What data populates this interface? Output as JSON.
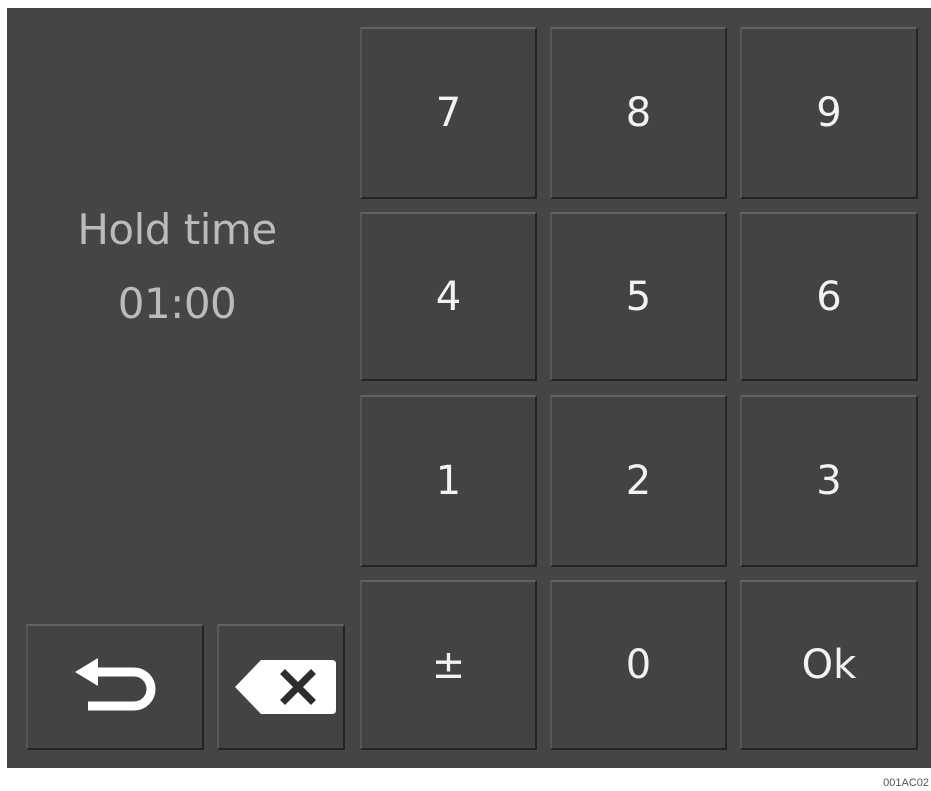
{
  "display": {
    "label": "Hold time",
    "value": "01:00"
  },
  "keypad": {
    "key_7": "7",
    "key_8": "8",
    "key_9": "9",
    "key_4": "4",
    "key_5": "5",
    "key_6": "6",
    "key_1": "1",
    "key_2": "2",
    "key_3": "3",
    "key_sign": "±",
    "key_0": "0",
    "key_ok": "Ok"
  },
  "icons": {
    "back": "back-arrow-icon",
    "clear": "backspace-clear-icon"
  },
  "footer": {
    "reference_code": "001AC02"
  },
  "colors": {
    "panel_background": "#444546",
    "key_background": "#424343",
    "key_text": "#f2f2f2",
    "label_text": "#b9bbbd"
  }
}
